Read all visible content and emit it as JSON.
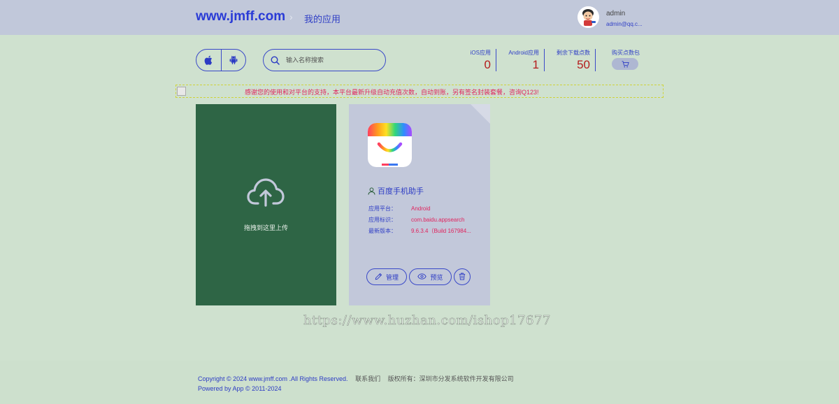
{
  "header": {
    "logo": "www.jmff.com",
    "separator": "›",
    "breadcrumb": "我的应用",
    "user": {
      "name": "admin",
      "email": "admin@qq.c..."
    }
  },
  "toolbar": {
    "platform_toggle": [
      "apple-icon",
      "android-icon"
    ],
    "search_placeholder": "输入名称搜索"
  },
  "stats": {
    "ios": {
      "label": "iOS应用",
      "value": "0"
    },
    "android": {
      "label": "Android应用",
      "value": "1"
    },
    "downloads": {
      "label": "剩余下载点数",
      "value": "50"
    },
    "buy": {
      "label": "购买点数包"
    }
  },
  "notice": {
    "text": "感谢您的使用和对平台的支持，本平台最新升级自动充值次数，自动到账，另有签名封装套餐，咨询Q123!"
  },
  "upload": {
    "label": "拖拽到这里上传"
  },
  "apps": [
    {
      "name": "百度手机助手",
      "meta": [
        {
          "key": "应用平台：",
          "value": "Android"
        },
        {
          "key": "应用标识：",
          "value": "com.baidu.appsearch"
        },
        {
          "key": "最新版本：",
          "value": "9.6.3.4（Build 167984..."
        }
      ],
      "actions": {
        "manage": "管理",
        "preview": "预览"
      }
    }
  ],
  "watermark": "https://www.huzhan.com/ishop17677",
  "footer": {
    "copyright": "Copyright © 2024 www.jmff.com .All Rights Reserved.",
    "contact": "联系我们",
    "owner": "版权所有：深圳市分发系统软件开发有限公司",
    "powered": "Powered by App © 2011-2024"
  },
  "colors": {
    "accent": "#2a3bd6",
    "danger": "#b41c1c",
    "upload_bg": "#2e6545",
    "card_bg": "#c2c8da",
    "page_bg": "#cfe1cf"
  }
}
